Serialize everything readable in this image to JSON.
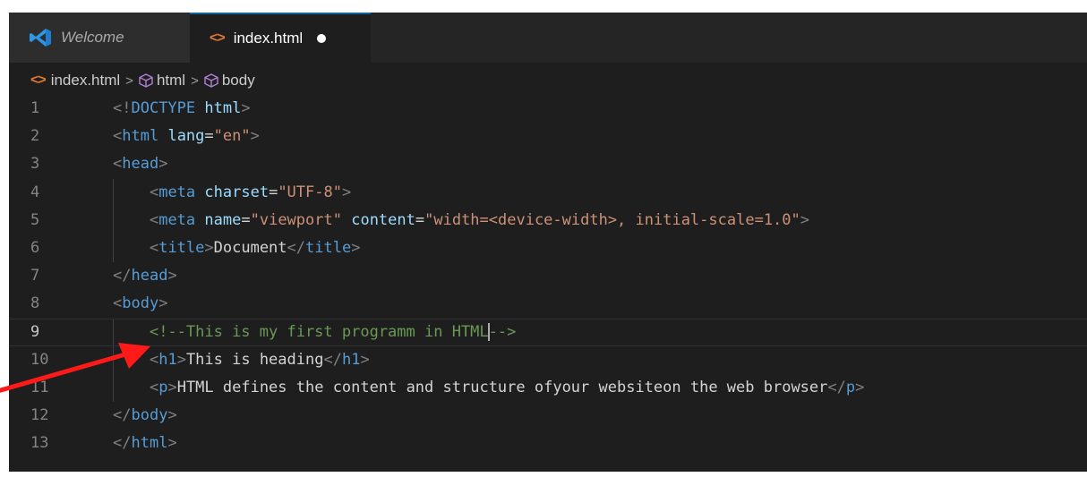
{
  "tabs": [
    {
      "label": "Welcome",
      "icon": "vscode-logo-icon",
      "active": false
    },
    {
      "label": "index.html",
      "icon": "html-file-icon",
      "active": true,
      "unsaved": true
    }
  ],
  "breadcrumb": [
    "index.html",
    "html",
    "body"
  ],
  "editor": {
    "current_line": 9,
    "lines": [
      {
        "n": "1",
        "tokens": [
          [
            "punct",
            "<!"
          ],
          [
            "tag",
            "DOCTYPE"
          ],
          [
            "text",
            " "
          ],
          [
            "attr",
            "html"
          ],
          [
            "punct",
            ">"
          ]
        ]
      },
      {
        "n": "2",
        "tokens": [
          [
            "punct",
            "<"
          ],
          [
            "tag",
            "html"
          ],
          [
            "text",
            " "
          ],
          [
            "attr",
            "lang"
          ],
          [
            "text",
            "="
          ],
          [
            "str",
            "\"en\""
          ],
          [
            "punct",
            ">"
          ]
        ]
      },
      {
        "n": "3",
        "tokens": [
          [
            "punct",
            "<"
          ],
          [
            "tag",
            "head"
          ],
          [
            "punct",
            ">"
          ]
        ]
      },
      {
        "n": "4",
        "tokens": [
          [
            "text",
            "    "
          ],
          [
            "punct",
            "<"
          ],
          [
            "tag",
            "meta"
          ],
          [
            "text",
            " "
          ],
          [
            "attr",
            "charset"
          ],
          [
            "text",
            "="
          ],
          [
            "str",
            "\"UTF-8\""
          ],
          [
            "punct",
            ">"
          ]
        ]
      },
      {
        "n": "5",
        "tokens": [
          [
            "text",
            "    "
          ],
          [
            "punct",
            "<"
          ],
          [
            "tag",
            "meta"
          ],
          [
            "text",
            " "
          ],
          [
            "attr",
            "name"
          ],
          [
            "text",
            "="
          ],
          [
            "str",
            "\"viewport\""
          ],
          [
            "text",
            " "
          ],
          [
            "attr",
            "content"
          ],
          [
            "text",
            "="
          ],
          [
            "str",
            "\"width=<device-width>, initial-scale=1.0\""
          ],
          [
            "punct",
            ">"
          ]
        ]
      },
      {
        "n": "6",
        "tokens": [
          [
            "text",
            "    "
          ],
          [
            "punct",
            "<"
          ],
          [
            "tag",
            "title"
          ],
          [
            "punct",
            ">"
          ],
          [
            "text",
            "Document"
          ],
          [
            "punct",
            "</"
          ],
          [
            "tag",
            "title"
          ],
          [
            "punct",
            ">"
          ]
        ]
      },
      {
        "n": "7",
        "tokens": [
          [
            "punct",
            "</"
          ],
          [
            "tag",
            "head"
          ],
          [
            "punct",
            ">"
          ]
        ]
      },
      {
        "n": "8",
        "tokens": [
          [
            "punct",
            "<"
          ],
          [
            "tag",
            "body"
          ],
          [
            "punct",
            ">"
          ]
        ]
      },
      {
        "n": "9",
        "tokens": [
          [
            "text",
            "    "
          ],
          [
            "comment",
            "<!--This is my first programm in HTML"
          ],
          [
            "caret",
            ""
          ],
          [
            "comment",
            "-->"
          ]
        ]
      },
      {
        "n": "10",
        "tokens": [
          [
            "text",
            "    "
          ],
          [
            "punct",
            "<"
          ],
          [
            "tag",
            "h1"
          ],
          [
            "punct",
            ">"
          ],
          [
            "text",
            "This is heading"
          ],
          [
            "punct",
            "</"
          ],
          [
            "tag",
            "h1"
          ],
          [
            "punct",
            ">"
          ]
        ]
      },
      {
        "n": "11",
        "tokens": [
          [
            "text",
            "    "
          ],
          [
            "punct",
            "<"
          ],
          [
            "tag",
            "p"
          ],
          [
            "punct",
            ">"
          ],
          [
            "text",
            "HTML defines the content and structure ofyour websiteon the web browser"
          ],
          [
            "punct",
            "</"
          ],
          [
            "tag",
            "p"
          ],
          [
            "punct",
            ">"
          ]
        ]
      },
      {
        "n": "12",
        "tokens": [
          [
            "punct",
            "</"
          ],
          [
            "tag",
            "body"
          ],
          [
            "punct",
            ">"
          ]
        ]
      },
      {
        "n": "13",
        "tokens": [
          [
            "punct",
            "</"
          ],
          [
            "tag",
            "html"
          ],
          [
            "punct",
            ">"
          ]
        ]
      }
    ]
  },
  "colors": {
    "editor_bg": "#1e1e1e",
    "tab_accent": "#0e639c",
    "tag": "#569cd6",
    "attribute": "#9cdcfe",
    "string": "#ce9178",
    "comment": "#6a9955",
    "annotation_arrow": "#ff1a1a"
  },
  "annotation": {
    "icon": "red-arrow-icon",
    "points_to_line": 9
  }
}
